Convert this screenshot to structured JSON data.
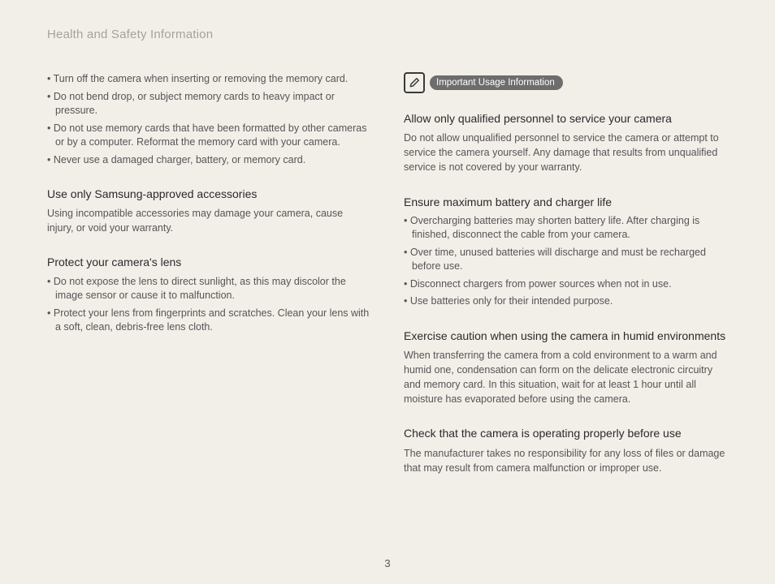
{
  "header": "Health and Safety Information",
  "page_number": "3",
  "left": {
    "list1": [
      "Turn off the camera when inserting or removing the memory card.",
      "Do not bend drop, or subject memory cards to heavy impact or pressure.",
      "Do not use memory cards that have been formatted by other cameras or by a computer. Reformat the memory card with your camera.",
      "Never use a damaged charger, battery, or memory card."
    ],
    "sec1_title": "Use only Samsung-approved accessories",
    "sec1_body": "Using incompatible accessories may damage your camera, cause injury, or void your warranty.",
    "sec2_title": "Protect your camera's lens",
    "sec2_list": [
      "Do not expose the lens to direct sunlight, as this may discolor the image sensor or cause it to malfunction.",
      "Protect your lens from fingerprints and scratches. Clean your lens with a soft, clean, debris-free lens cloth."
    ]
  },
  "right": {
    "badge_label": "Important Usage Information",
    "sec1_title": "Allow only qualified personnel to service your camera",
    "sec1_body": "Do not allow unqualified personnel to service the camera or attempt to service the camera yourself. Any damage that results from unqualified service is not covered by your warranty.",
    "sec2_title": "Ensure maximum battery and charger life",
    "sec2_list": [
      "Overcharging batteries may shorten battery life. After charging is finished, disconnect the cable from your camera.",
      "Over time, unused batteries will discharge and must be recharged before use.",
      "Disconnect chargers from power sources when not in use.",
      "Use batteries only for their intended purpose."
    ],
    "sec3_title": "Exercise caution when using the camera in humid environments",
    "sec3_body": "When transferring the camera from a cold environment to a warm and humid one, condensation can form on the delicate electronic circuitry and memory card. In this situation, wait for at least 1 hour until all moisture has evaporated before using the camera.",
    "sec4_title": "Check that the camera is operating properly before use",
    "sec4_body": "The manufacturer takes no responsibility for any loss of files or damage that may result from camera malfunction or improper use."
  }
}
